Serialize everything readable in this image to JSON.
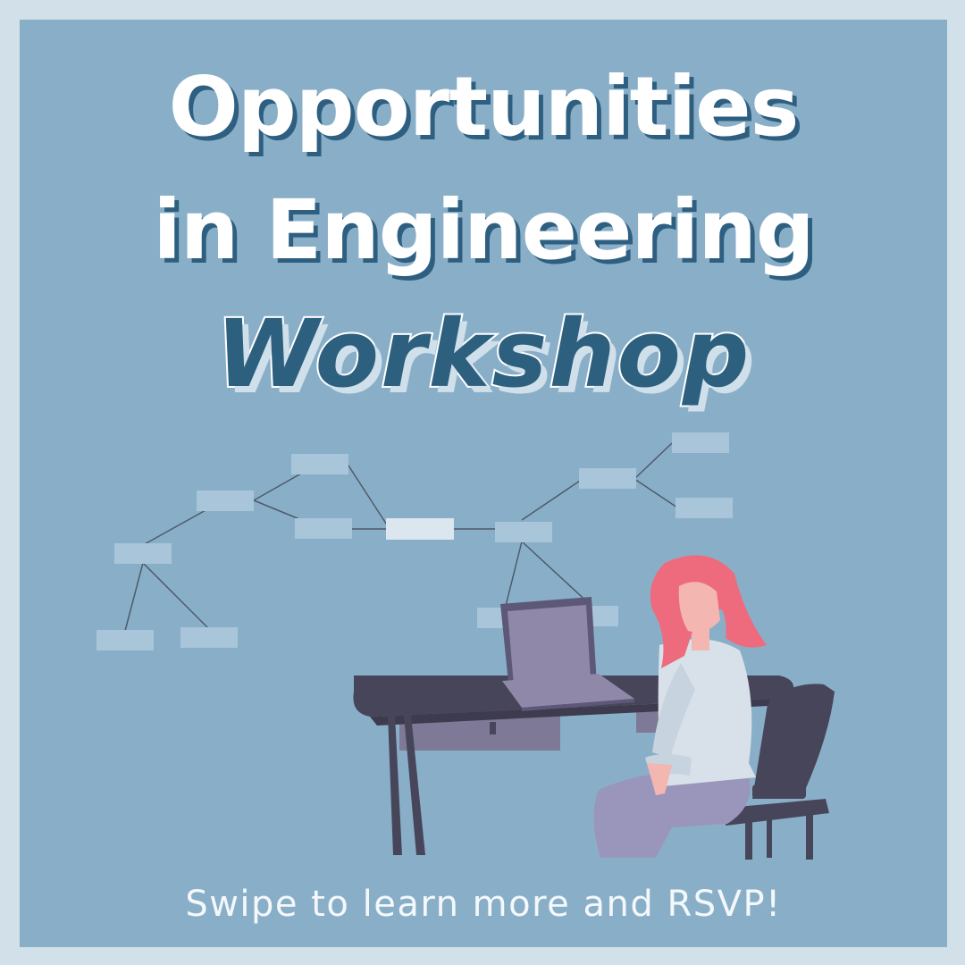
{
  "title": {
    "line1": "Opportunities",
    "line2": "in Engineering",
    "line3": "Workshop"
  },
  "footer": {
    "text": "Swipe to learn more and RSVP!"
  },
  "colors": {
    "background": "#89afc8",
    "border": "#d2e0ea",
    "title_fill": "#ffffff",
    "title_shadow": "#2e5f80",
    "workshop_fill": "#2d5f7e",
    "hair": "#ee6b7e",
    "desk": "#474559",
    "laptop": "#8f88a8"
  },
  "illustration": {
    "subject": "woman-at-desk-with-laptop",
    "background": "mind-map-boxes"
  }
}
